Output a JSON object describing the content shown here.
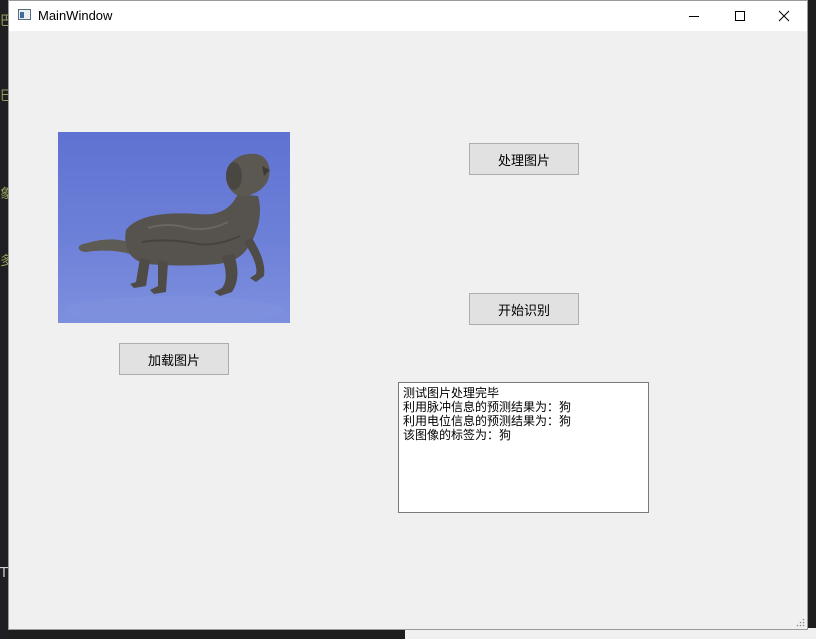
{
  "desktop": {
    "left_glyphs": [
      "巴",
      "巳",
      "象",
      "多",
      "T"
    ]
  },
  "window": {
    "title": "MainWindow",
    "controls": {
      "minimize": "minimize-icon",
      "maximize": "maximize-icon",
      "close": "close-icon"
    }
  },
  "image_panel": {
    "description_icon": "dog-photo"
  },
  "buttons": {
    "load_image": "加载图片",
    "process_image": "处理图片",
    "start_recognition": "开始识别"
  },
  "output": {
    "lines": [
      "测试图片处理完毕",
      "利用脉冲信息的预测结果为：狗",
      "利用电位信息的预测结果为：狗",
      "该图像的标签为：狗"
    ]
  },
  "colors": {
    "photo_background": "#6274d2",
    "dog": "#5a5752"
  }
}
